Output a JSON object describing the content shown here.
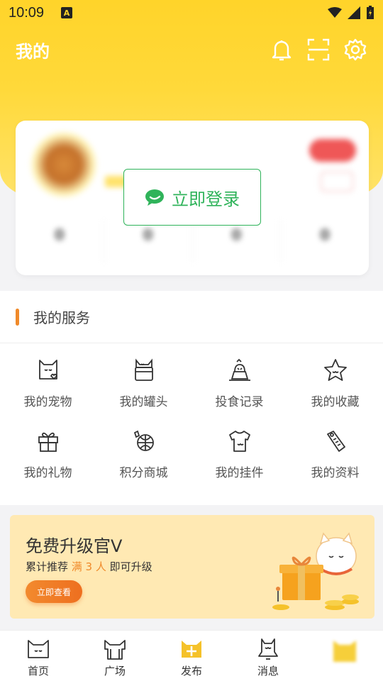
{
  "status_bar": {
    "time": "10:09",
    "badge": "A"
  },
  "header": {
    "title": "我的"
  },
  "profile": {
    "blurred_stats": [
      {
        "value": "0"
      },
      {
        "value": "0"
      },
      {
        "value": "0"
      },
      {
        "value": "0"
      }
    ],
    "login_label": "立即登录"
  },
  "services": {
    "title": "我的服务",
    "items": [
      {
        "label": "我的宠物",
        "icon": "pet-cat-icon"
      },
      {
        "label": "我的罐头",
        "icon": "can-icon"
      },
      {
        "label": "投食记录",
        "icon": "feeding-icon"
      },
      {
        "label": "我的收藏",
        "icon": "star-icon"
      },
      {
        "label": "我的礼物",
        "icon": "gift-icon"
      },
      {
        "label": "积分商城",
        "icon": "points-mall-icon"
      },
      {
        "label": "我的挂件",
        "icon": "tshirt-icon"
      },
      {
        "label": "我的资料",
        "icon": "profile-tag-icon"
      }
    ]
  },
  "banner": {
    "title": "免费升级官V",
    "desc_prefix": "累计推荐 ",
    "desc_highlight": "满 3 人",
    "desc_suffix": " 即可升级",
    "cta": "立即查看"
  },
  "tabbar": {
    "items": [
      {
        "label": "首页",
        "icon": "home-cat-icon"
      },
      {
        "label": "广场",
        "icon": "square-icon"
      },
      {
        "label": "发布",
        "icon": "publish-plus-icon"
      },
      {
        "label": "消息",
        "icon": "message-icon"
      },
      {
        "label": "",
        "icon": "me-avatar-icon"
      }
    ]
  },
  "colors": {
    "accent": "#ffd42a",
    "orange": "#f08a2a",
    "green": "#2fb35a",
    "red": "#ef5757"
  }
}
